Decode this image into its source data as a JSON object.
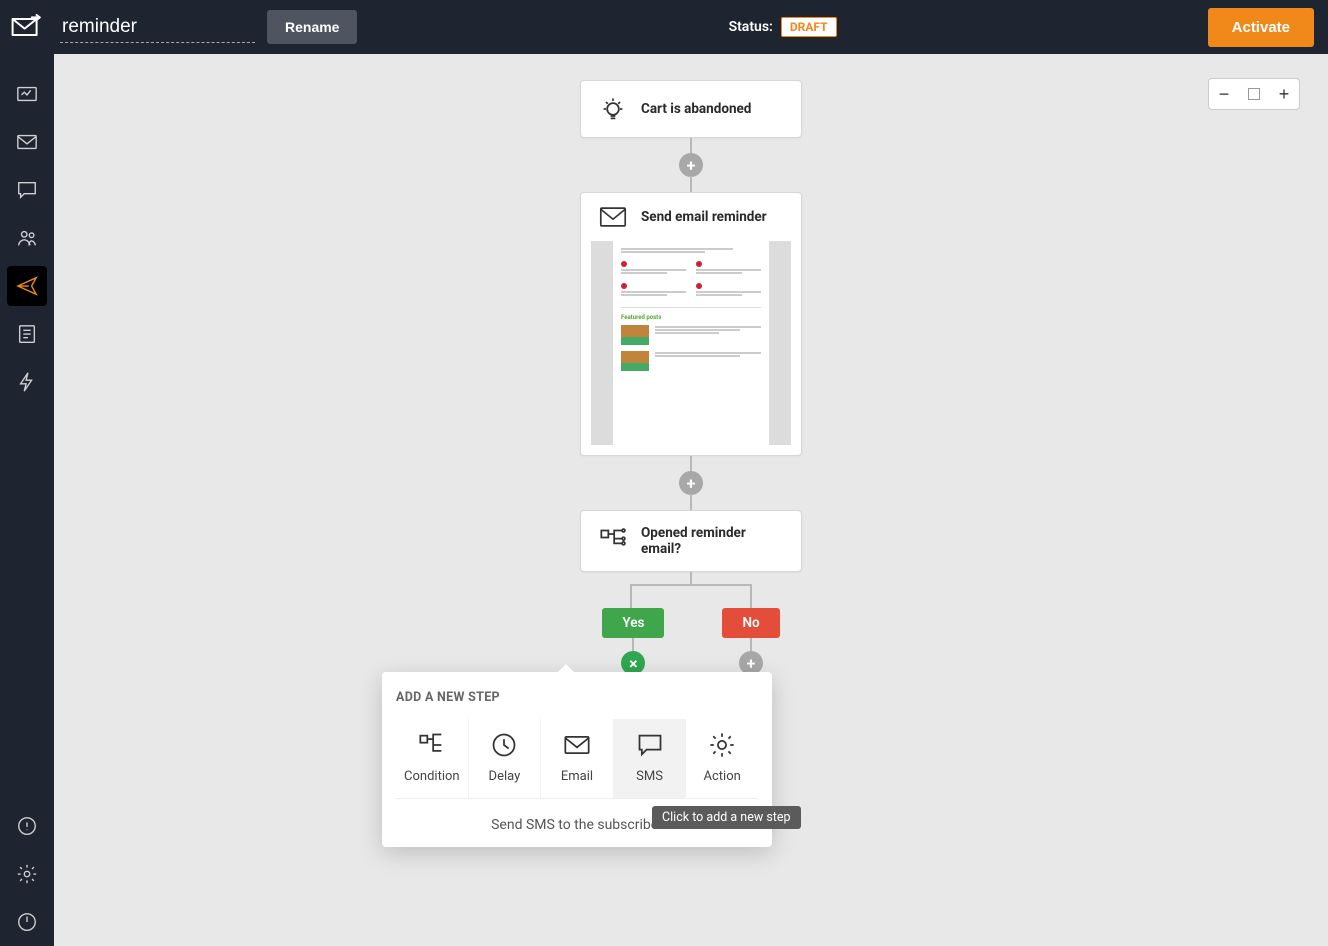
{
  "header": {
    "workflow_name": "reminder",
    "rename_label": "Rename",
    "status_label": "Status:",
    "status_badge": "DRAFT",
    "activate_label": "Activate"
  },
  "sidebar": {
    "items": [
      {
        "name": "dashboard",
        "icon": "dashboard"
      },
      {
        "name": "campaigns",
        "icon": "mail"
      },
      {
        "name": "chat",
        "icon": "chat"
      },
      {
        "name": "contacts",
        "icon": "people"
      },
      {
        "name": "automations",
        "icon": "plane",
        "active": true
      },
      {
        "name": "forms",
        "icon": "list"
      },
      {
        "name": "integrations",
        "icon": "bolt"
      }
    ],
    "footer": [
      {
        "name": "help",
        "icon": "info"
      },
      {
        "name": "settings",
        "icon": "gear"
      },
      {
        "name": "logout",
        "icon": "power"
      }
    ]
  },
  "zoom": {
    "out": "−",
    "in": "+"
  },
  "flow": {
    "trigger_title": "Cart is abandoned",
    "email_step_title": "Send email reminder",
    "condition_title": "Opened reminder email?",
    "yes_label": "Yes",
    "no_label": "No"
  },
  "popover": {
    "title": "ADD A NEW STEP",
    "options": [
      {
        "key": "condition",
        "label": "Condition"
      },
      {
        "key": "delay",
        "label": "Delay"
      },
      {
        "key": "email",
        "label": "Email"
      },
      {
        "key": "sms",
        "label": "SMS",
        "hover": true
      },
      {
        "key": "action",
        "label": "Action"
      }
    ],
    "description": "Send SMS to the subscriber",
    "tooltip": "Click to add a new step"
  }
}
